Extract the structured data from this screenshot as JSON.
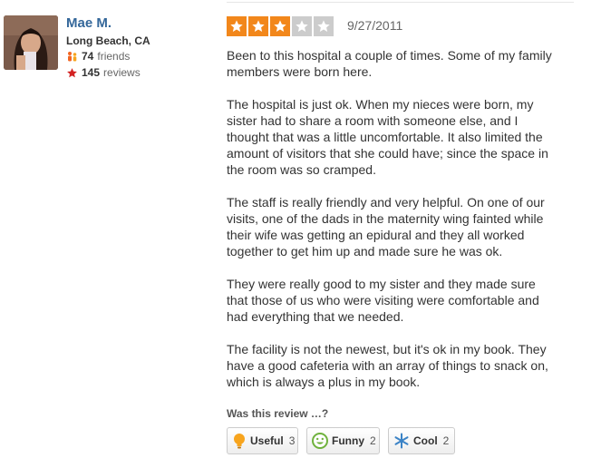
{
  "reviewer": {
    "name": "Mae M.",
    "location": "Long Beach, CA",
    "friends_count": "74",
    "friends_label": "friends",
    "reviews_count": "145",
    "reviews_label": "reviews",
    "avatar_alt": "avatar photo"
  },
  "review": {
    "rating": 3,
    "rating_max": 5,
    "date": "9/27/2011",
    "paragraphs": [
      "Been to this hospital a couple of times.  Some of my family\nmembers were born here.",
      "The hospital is just ok.  When my nieces were born, my\nsister had to share a room with someone else, and I\nthought that was a little uncomfortable.  It also limited the\namount of visitors that she could have; since the space in\nthe room was so cramped.",
      "The staff is really friendly and very helpful.  On one of our\nvisits, one of the dads in the maternity wing fainted while\ntheir wife was getting an epidural and they all worked\ntogether to get him up and made sure he was ok.",
      "They were really good to my sister and they made sure\nthat those of us who were visiting were comfortable and\nhad everything that we needed.",
      "The facility is not the newest, but it's ok in my book.  They\nhave a good cafeteria with an array of things to snack on,\nwhich is always a plus in my book."
    ]
  },
  "feedback": {
    "prompt": "Was this review …?",
    "buttons": [
      {
        "label": "Useful",
        "count": "3",
        "icon": "lightbulb-icon"
      },
      {
        "label": "Funny",
        "count": "2",
        "icon": "smiley-icon"
      },
      {
        "label": "Cool",
        "count": "2",
        "icon": "snowflake-icon"
      }
    ]
  },
  "colors": {
    "star_on": "#f2871b",
    "star_off": "#cccccc",
    "link": "#34679a",
    "useful_icon": "#f7a41d",
    "funny_icon": "#6fb23d",
    "cool_icon": "#3b83c6"
  }
}
